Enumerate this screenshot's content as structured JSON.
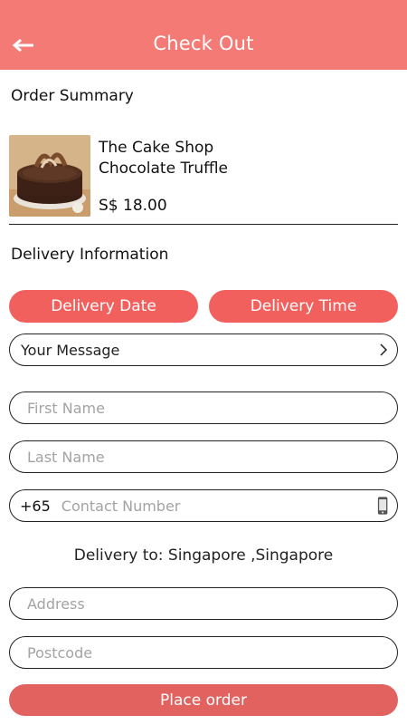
{
  "header": {
    "title": "Check Out",
    "back_icon": "arrow-left-icon"
  },
  "order_summary": {
    "title": "Order Summary",
    "item": {
      "shop": "The Cake Shop",
      "name": "Chocolate Truffle",
      "price": "S$ 18.00",
      "image": "chocolate-cake-image"
    }
  },
  "delivery": {
    "title": "Delivery Information",
    "date_button": "Delivery Date",
    "time_button": "Delivery Time",
    "message_label": "Your Message",
    "first_name_placeholder": "First Name",
    "last_name_placeholder": "Last Name",
    "phone_prefix": "+65",
    "contact_placeholder": "Contact Number",
    "delivery_to": "Delivery to: Singapore ,Singapore",
    "address_placeholder": "Address",
    "postcode_placeholder": "Postcode"
  },
  "actions": {
    "place_order": "Place order"
  },
  "colors": {
    "header": "#f47a76",
    "button": "#f2605d",
    "place_order": "#e1625f"
  }
}
